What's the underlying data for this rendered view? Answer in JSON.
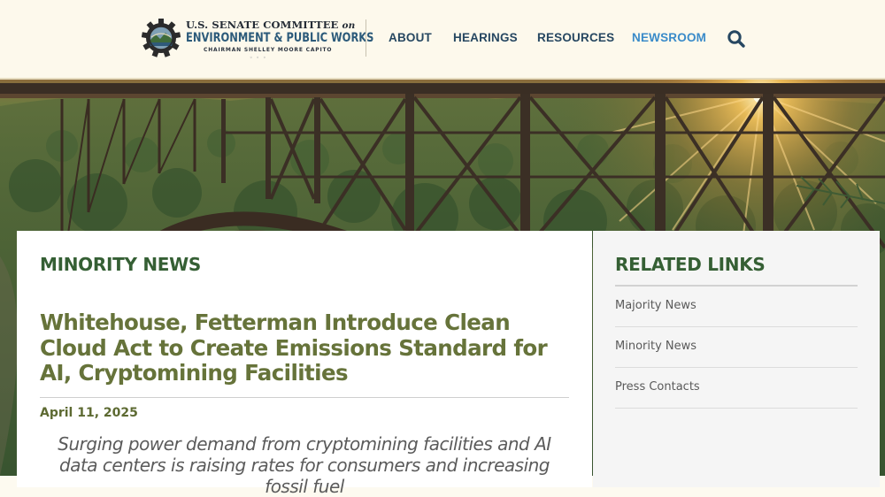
{
  "header": {
    "logo": {
      "line1": "U.S. SENATE COMMITTEE",
      "line1_suffix": "on",
      "line2": "ENVIRONMENT & PUBLIC WORKS",
      "line3": "CHAIRMAN SHELLEY MOORE CAPITO",
      "dots": "◦◦◦"
    },
    "nav": [
      {
        "label": "ABOUT",
        "active": false
      },
      {
        "label": "HEARINGS",
        "active": false
      },
      {
        "label": "RESOURCES",
        "active": false
      },
      {
        "label": "NEWSROOM",
        "active": true
      }
    ],
    "search_icon": "search-icon"
  },
  "hero": {
    "image": "new-river-gorge-bridge-sunset"
  },
  "main": {
    "section_label": "MINORITY NEWS",
    "title": "Whitehouse, Fetterman Introduce Clean Cloud Act to Create Emissions Standard for AI, Cryptomining Facilities",
    "date": "April 11, 2025",
    "deck": "Surging power demand from cryptomining facilities and AI data centers is raising rates for consumers and increasing fossil fuel"
  },
  "sidebar": {
    "title": "RELATED LINKS",
    "links": [
      {
        "label": "Majority News"
      },
      {
        "label": "Minority News"
      },
      {
        "label": "Press Contacts"
      }
    ]
  },
  "colors": {
    "header_bg": "#fdf9ec",
    "nav_text": "#264761",
    "nav_active": "#3a8bc9",
    "section_green": "#355f34",
    "title_olive": "#66733a",
    "sidebar_bg": "#f5f5f5"
  }
}
